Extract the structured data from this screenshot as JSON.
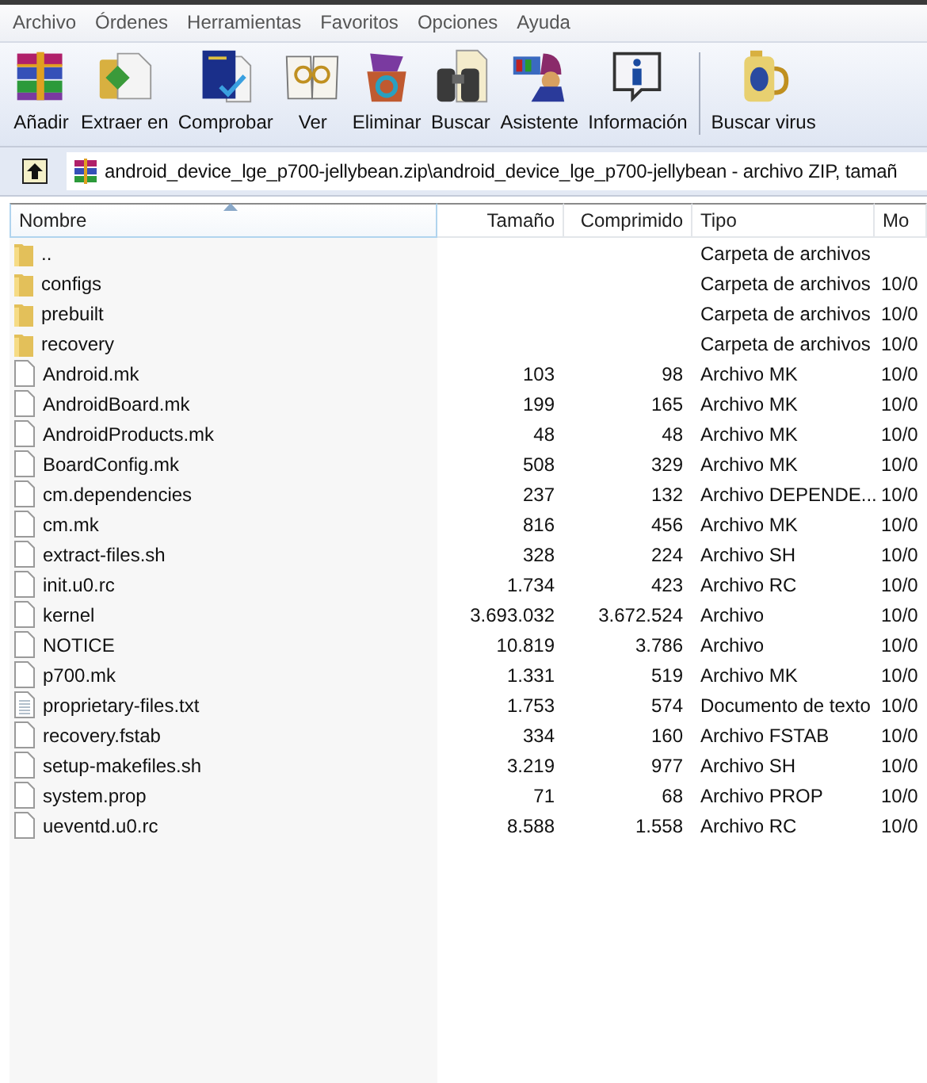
{
  "menu": [
    "Archivo",
    "Órdenes",
    "Herramientas",
    "Favoritos",
    "Opciones",
    "Ayuda"
  ],
  "toolbar": [
    {
      "label": "Añadir",
      "separator_before": false
    },
    {
      "label": "Extraer en",
      "separator_before": false
    },
    {
      "label": "Comprobar",
      "separator_before": false
    },
    {
      "label": "Ver",
      "separator_before": false
    },
    {
      "label": "Eliminar",
      "separator_before": false
    },
    {
      "label": "Buscar",
      "separator_before": false
    },
    {
      "label": "Asistente",
      "separator_before": false
    },
    {
      "label": "Información",
      "separator_before": false
    },
    {
      "label": "Buscar virus",
      "separator_before": true
    }
  ],
  "address": {
    "path": "android_device_lge_p700-jellybean.zip\\android_device_lge_p700-jellybean - archivo ZIP, tamañ"
  },
  "table": {
    "columns": [
      {
        "label": "Nombre",
        "sorted": true
      },
      {
        "label": "Tamaño",
        "sorted": false
      },
      {
        "label": "Comprimido",
        "sorted": false
      },
      {
        "label": "Tipo",
        "sorted": false
      },
      {
        "label": "Mo",
        "sorted": false
      }
    ],
    "rows": [
      {
        "kind": "folder",
        "name": "..",
        "size": "",
        "packed": "",
        "type": "Carpeta de archivos",
        "modified": ""
      },
      {
        "kind": "folder",
        "name": "configs",
        "size": "",
        "packed": "",
        "type": "Carpeta de archivos",
        "modified": "10/0"
      },
      {
        "kind": "folder",
        "name": "prebuilt",
        "size": "",
        "packed": "",
        "type": "Carpeta de archivos",
        "modified": "10/0"
      },
      {
        "kind": "folder",
        "name": "recovery",
        "size": "",
        "packed": "",
        "type": "Carpeta de archivos",
        "modified": "10/0"
      },
      {
        "kind": "file",
        "name": "Android.mk",
        "size": "103",
        "packed": "98",
        "type": "Archivo MK",
        "modified": "10/0"
      },
      {
        "kind": "file",
        "name": "AndroidBoard.mk",
        "size": "199",
        "packed": "165",
        "type": "Archivo MK",
        "modified": "10/0"
      },
      {
        "kind": "file",
        "name": "AndroidProducts.mk",
        "size": "48",
        "packed": "48",
        "type": "Archivo MK",
        "modified": "10/0"
      },
      {
        "kind": "file",
        "name": "BoardConfig.mk",
        "size": "508",
        "packed": "329",
        "type": "Archivo MK",
        "modified": "10/0"
      },
      {
        "kind": "file",
        "name": "cm.dependencies",
        "size": "237",
        "packed": "132",
        "type": "Archivo DEPENDE...",
        "modified": "10/0"
      },
      {
        "kind": "file",
        "name": "cm.mk",
        "size": "816",
        "packed": "456",
        "type": "Archivo MK",
        "modified": "10/0"
      },
      {
        "kind": "file",
        "name": "extract-files.sh",
        "size": "328",
        "packed": "224",
        "type": "Archivo SH",
        "modified": "10/0"
      },
      {
        "kind": "file",
        "name": "init.u0.rc",
        "size": "1.734",
        "packed": "423",
        "type": "Archivo RC",
        "modified": "10/0"
      },
      {
        "kind": "file",
        "name": "kernel",
        "size": "3.693.032",
        "packed": "3.672.524",
        "type": "Archivo",
        "modified": "10/0"
      },
      {
        "kind": "file",
        "name": "NOTICE",
        "size": "10.819",
        "packed": "3.786",
        "type": "Archivo",
        "modified": "10/0"
      },
      {
        "kind": "file",
        "name": "p700.mk",
        "size": "1.331",
        "packed": "519",
        "type": "Archivo MK",
        "modified": "10/0"
      },
      {
        "kind": "text",
        "name": "proprietary-files.txt",
        "size": "1.753",
        "packed": "574",
        "type": "Documento de texto",
        "modified": "10/0"
      },
      {
        "kind": "file",
        "name": "recovery.fstab",
        "size": "334",
        "packed": "160",
        "type": "Archivo FSTAB",
        "modified": "10/0"
      },
      {
        "kind": "file",
        "name": "setup-makefiles.sh",
        "size": "3.219",
        "packed": "977",
        "type": "Archivo SH",
        "modified": "10/0"
      },
      {
        "kind": "file",
        "name": "system.prop",
        "size": "71",
        "packed": "68",
        "type": "Archivo PROP",
        "modified": "10/0"
      },
      {
        "kind": "file",
        "name": "ueventd.u0.rc",
        "size": "8.588",
        "packed": "1.558",
        "type": "Archivo RC",
        "modified": "10/0"
      }
    ]
  }
}
